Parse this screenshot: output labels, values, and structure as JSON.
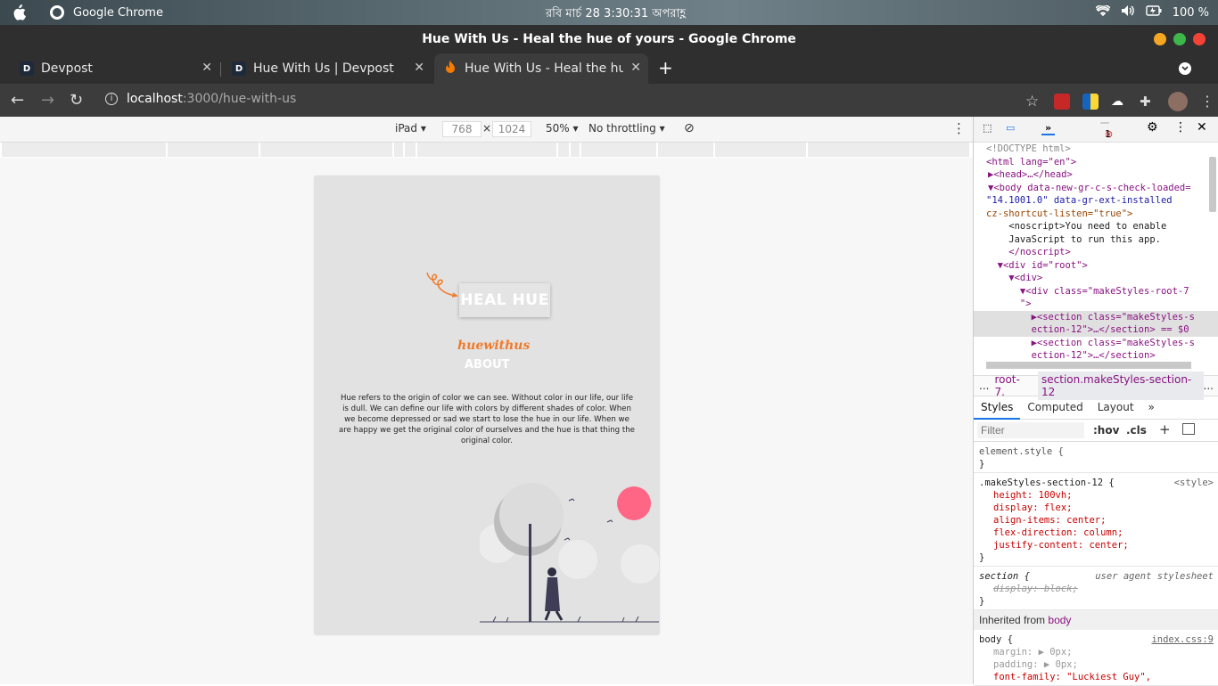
{
  "os": {
    "app_name": "Google Chrome",
    "clock": "রবি মার্চ 28  3:30:31 অপরাহ্ণ",
    "battery": "100 %"
  },
  "window": {
    "title": "Hue With Us - Heal the hue of yours - Google Chrome"
  },
  "tabs": [
    {
      "label": "Devpost",
      "favicon": "D"
    },
    {
      "label": "Hue With Us | Devpost",
      "favicon": "D"
    },
    {
      "label": "Hue With Us - Heal the hu",
      "favicon": "flame-icon"
    }
  ],
  "omnibox": {
    "host": "localhost",
    "path": ":3000/hue-with-us"
  },
  "device_toolbar": {
    "device": "iPad",
    "width": "768",
    "height": "1024",
    "zoom": "50%",
    "throttle": "No throttling",
    "times": "×"
  },
  "page": {
    "logo_text": "HEAL HUE",
    "brand": "huewithus",
    "about_heading": "ABOUT",
    "description": "Hue refers to the origin of color we can see. Without color in our life, our life is dull. We can define our life with colors by different shades of color. When we become depressed or sad we start to lose the hue in our life. When we are happy we get the original color of ourselves and the hue is that thing the original color."
  },
  "devtools": {
    "error_count": "1",
    "breadcrumb_left": "root-7.",
    "breadcrumb_right": "section.makeStyles-section-12",
    "more": "...",
    "subtabs": [
      "Styles",
      "Computed",
      "Layout",
      "»"
    ],
    "filter_placeholder": "Filter",
    "hov": ":hov",
    "cls": ".cls",
    "dom_lines": [
      "<!DOCTYPE html>",
      "<html lang=\"en\">",
      "▶<head>…</head>",
      "▼<body data-new-gr-c-s-check-loaded=",
      "\"14.1001.0\" data-gr-ext-installed",
      "cz-shortcut-listen=\"true\">",
      "    <noscript>You need to enable",
      "    JavaScript to run this app.",
      "    </noscript>",
      "  ▼<div id=\"root\">",
      "    ▼<div>",
      "      ▼<div class=\"makeStyles-root-7",
      "      \">",
      "        ▶<section class=\"makeStyles-s",
      "        ection-12\">…</section> == $0",
      "        ▶<section class=\"makeStyles-s",
      "        ection-12\">…</section>"
    ],
    "element_style": "element.style {",
    "rule1_selector": ".makeStyles-section-12 {",
    "rule1_source": "<style>",
    "rule1_props": [
      "height: 100vh;",
      "display: flex;",
      "align-items: center;",
      "flex-direction: column;",
      "justify-content: center;"
    ],
    "rule2_selector": "section {",
    "rule2_source": "user agent stylesheet",
    "rule2_prop": "display: block;",
    "inherited_label": "Inherited from",
    "inherited_from": "body",
    "rule3_selector": "body {",
    "rule3_source": "index.css:9",
    "rule3_props": [
      "margin: ▶ 0px;",
      "padding: ▶ 0px;",
      "font-family: \"Luckiest Guy\","
    ],
    "close_brace": "}"
  },
  "colors": {
    "brand": "#f07a2a",
    "accent_circle": "#ff6584",
    "page_bg": "#e2e2e2"
  }
}
